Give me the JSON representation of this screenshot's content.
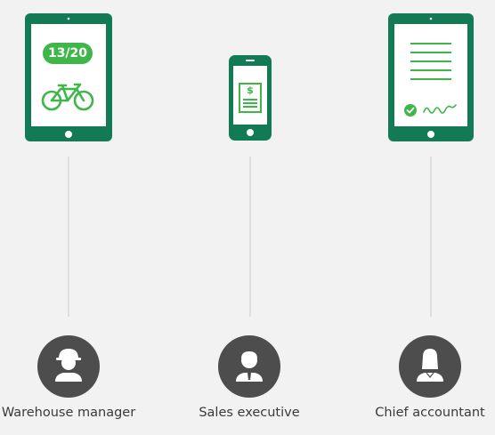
{
  "colors": {
    "brand_dark": "#127a55",
    "brand_light": "#3fb54a",
    "avatar": "#4d4d4d",
    "line": "#dedede"
  },
  "warehouse": {
    "device": "tablet",
    "badge_text": "13/20",
    "screen_icon": "bicycle-icon",
    "role_label": "Warehouse manager",
    "avatar_icon": "hard-hat-worker-icon"
  },
  "sales": {
    "device": "phone",
    "screen_icon": "invoice-dollar-icon",
    "document_symbol": "$",
    "role_label": "Sales executive",
    "avatar_icon": "businessman-icon"
  },
  "accountant": {
    "device": "tablet",
    "screen_icon": "signed-document-icon",
    "role_label": "Chief accountant",
    "avatar_icon": "businesswoman-icon"
  }
}
